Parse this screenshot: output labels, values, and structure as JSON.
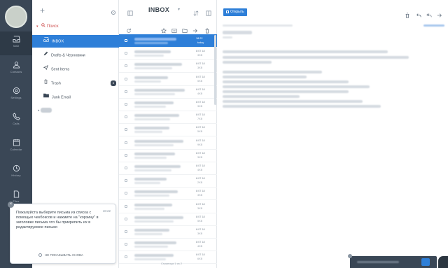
{
  "rail": {
    "items": [
      {
        "icon": "inbox-icon",
        "caption": "Mail"
      },
      {
        "icon": "contacts-icon",
        "caption": "Contacts"
      },
      {
        "icon": "settings-icon",
        "caption": "Settings"
      },
      {
        "icon": "phone-icon",
        "caption": "Calls"
      },
      {
        "icon": "calendar-icon",
        "caption": "Calendar"
      },
      {
        "icon": "clock-icon",
        "caption": "History"
      },
      {
        "icon": "document-icon",
        "caption": "Files"
      },
      {
        "icon": "tasks-icon",
        "caption": "Tasks"
      },
      {
        "icon": "folder-icon",
        "caption": ""
      }
    ]
  },
  "folders": {
    "search_label": "Поиск",
    "items": [
      {
        "label": "INBOX",
        "icon": "inbox-icon",
        "active": true,
        "count": ""
      },
      {
        "label": "Drafts & Черновики",
        "icon": "pencil-icon",
        "active": false,
        "count": ""
      },
      {
        "label": "Sent Items",
        "icon": "sent-icon",
        "active": false,
        "count": ""
      },
      {
        "label": "Trash",
        "icon": "trash-icon",
        "active": false,
        "count": "5"
      },
      {
        "label": "Junk Email",
        "icon": "junk-folder-icon",
        "active": false,
        "count": ""
      }
    ]
  },
  "tooltip": {
    "time": "18:22",
    "text": "Пожалуйста выберите письма из списка с помощью чекбоксов и нажмите на \"корзину\" в заголовке письма что бы прикрепить их в редактируемое письмо",
    "dont_show": "НЕ ПОКАЗЫВАТЬ СНОВА"
  },
  "msglist": {
    "title": "INBOX",
    "rows": [
      {
        "d1": "18:22",
        "d2": "today",
        "selected": true
      },
      {
        "d1": "8:07 18",
        "d2": "3KB",
        "selected": false
      },
      {
        "d1": "8:07 18",
        "d2": "3KB",
        "selected": false
      },
      {
        "d1": "8:07 18",
        "d2": "5KB",
        "selected": false
      },
      {
        "d1": "8:07 18",
        "d2": "4KB",
        "selected": false
      },
      {
        "d1": "8:07 18",
        "d2": "3KB",
        "selected": false
      },
      {
        "d1": "8:07 18",
        "d2": "7KB",
        "selected": false
      },
      {
        "d1": "8:07 18",
        "d2": "5KB",
        "selected": false
      },
      {
        "d1": "8:07 18",
        "d2": "9KB",
        "selected": false
      },
      {
        "d1": "8:07 18",
        "d2": "3KB",
        "selected": false
      },
      {
        "d1": "8:07 18",
        "d2": "4KB",
        "selected": false
      },
      {
        "d1": "8:07 18",
        "d2": "2KB",
        "selected": false
      },
      {
        "d1": "8:07 18",
        "d2": "3KB",
        "selected": false
      },
      {
        "d1": "8:07 18",
        "d2": "3KB",
        "selected": false
      },
      {
        "d1": "8:07 18",
        "d2": "5KB",
        "selected": false
      },
      {
        "d1": "8:07 18",
        "d2": "3KB",
        "selected": false
      },
      {
        "d1": "8:07 18",
        "d2": "4KB",
        "selected": false
      },
      {
        "d1": "8:07 18",
        "d2": "6KB",
        "selected": false
      }
    ],
    "pager": "Страница 1 из 2"
  },
  "reader": {
    "open_label": "Открыть"
  },
  "colors": {
    "accent": "#2e7fd8",
    "rail": "#3a4756",
    "search": "#d05555"
  }
}
